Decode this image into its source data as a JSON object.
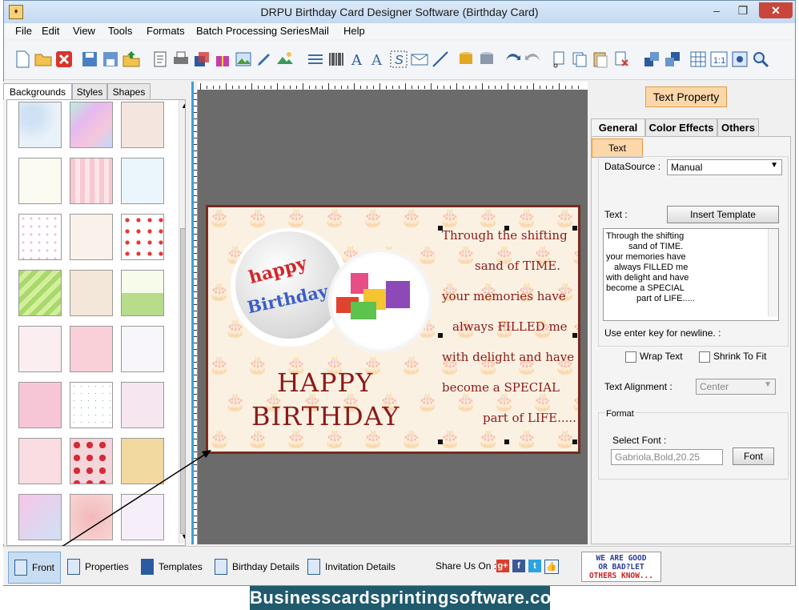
{
  "window": {
    "title": "DRPU Birthday Card Designer Software (Birthday Card)",
    "minimize_glyph": "–",
    "maximize_glyph": "❐",
    "close_glyph": "✕"
  },
  "menu": [
    "File",
    "Edit",
    "View",
    "Tools",
    "Formats",
    "Batch Processing Series",
    "Mail",
    "Help"
  ],
  "left_panel": {
    "tabs": [
      "Backgrounds",
      "Styles",
      "Shapes"
    ],
    "active_tab": "Backgrounds"
  },
  "card": {
    "badge_word_1": "happy",
    "badge_word_2": "Birthday",
    "heading_line_1": "HAPPY",
    "heading_line_2": "BIRTHDAY",
    "message_lines": [
      "Through the shifting",
      "sand of TIME.",
      "your memories have",
      "always FILLED me",
      "with delight and have",
      "become a SPECIAL",
      "part of LIFE....."
    ]
  },
  "right_panel": {
    "title": "Text Property",
    "tabs": [
      "General",
      "Color Effects",
      "Others"
    ],
    "active_tab": "General",
    "text_group_label": "Text",
    "datasource_label": "DataSource :",
    "datasource_value": "Manual",
    "text_label": "Text :",
    "insert_template_button": "Insert Template",
    "text_value": [
      "Through the shifting",
      "sand of TIME.",
      "your memories have",
      "always FILLED me",
      "with delight and have",
      "become a SPECIAL",
      "part of LIFE....."
    ],
    "hint": "Use enter key for newline. :",
    "wrap_text_label": "Wrap Text",
    "shrink_to_fit_label": "Shrink To Fit",
    "alignment_label": "Text Alignment :",
    "alignment_value": "Center",
    "format_group_label": "Format",
    "select_font_label": "Select Font :",
    "font_value": "Gabriola,Bold,20.25",
    "font_button": "Font"
  },
  "status_bar": {
    "front": "Front",
    "properties": "Properties",
    "templates": "Templates",
    "birthday_details": "Birthday Details",
    "invitation_details": "Invitation Details",
    "share_label": "Share Us On :",
    "banner_line_1": "WE ARE GOOD",
    "banner_line_2": "OR BAD?LET",
    "banner_line_3": "OTHERS KNOW..."
  },
  "footer": {
    "site": "Businesscardsprintingsoftware.com"
  },
  "colors": {
    "card_text": "#8b1a1a",
    "card_border": "#7a2a1e",
    "canvas_bg": "#6b6b6b",
    "footer_bg": "#1f5a6d",
    "accent_orange": "#fcd7a9"
  }
}
